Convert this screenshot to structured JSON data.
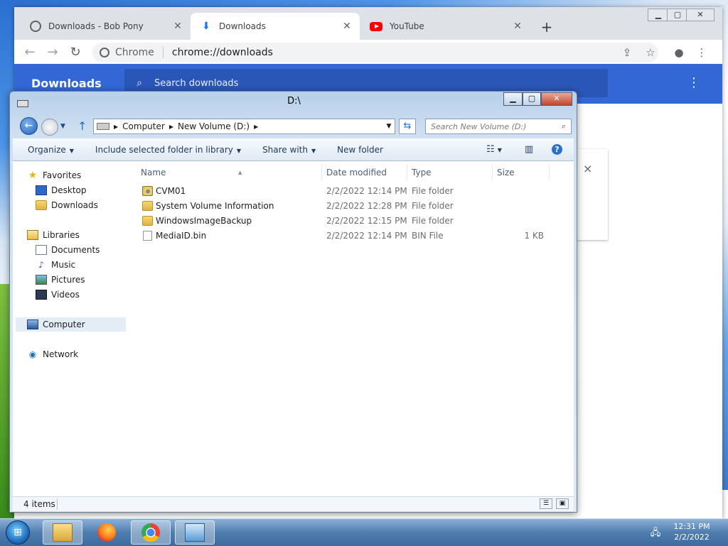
{
  "chrome": {
    "tabs": [
      {
        "title": "Downloads - Bob Pony",
        "favicon": "globe-icon",
        "active": false
      },
      {
        "title": "Downloads",
        "favicon": "download-icon",
        "active": true
      },
      {
        "title": "YouTube",
        "favicon": "youtube-icon",
        "active": false
      }
    ],
    "new_tab_label": "+",
    "omnibox": {
      "chip": "Chrome",
      "url": "chrome://downloads"
    },
    "page": {
      "title": "Downloads",
      "search_placeholder": "Search downloads"
    },
    "card_close": "×"
  },
  "explorer": {
    "title": "D:\\",
    "breadcrumbs": [
      "Computer",
      "New Volume (D:)"
    ],
    "search_placeholder": "Search New Volume (D:)",
    "commands": [
      {
        "label": "Organize",
        "dropdown": true
      },
      {
        "label": "Include selected folder in library",
        "dropdown": true
      },
      {
        "label": "Share with",
        "dropdown": true
      },
      {
        "label": "New folder",
        "dropdown": false
      }
    ],
    "nav": {
      "favorites": {
        "label": "Favorites",
        "items": [
          "Desktop",
          "Downloads"
        ]
      },
      "libraries": {
        "label": "Libraries",
        "items": [
          "Documents",
          "Music",
          "Pictures",
          "Videos"
        ]
      },
      "computer": "Computer",
      "network": "Network"
    },
    "columns": [
      "Name",
      "Date modified",
      "Type",
      "Size"
    ],
    "files": [
      {
        "name": "CVM01",
        "date": "2/2/2022 12:14 PM",
        "type": "File folder",
        "size": "",
        "icon": "mounted-folder-icon"
      },
      {
        "name": "System Volume Information",
        "date": "2/2/2022 12:28 PM",
        "type": "File folder",
        "size": "",
        "icon": "folder-icon"
      },
      {
        "name": "WindowsImageBackup",
        "date": "2/2/2022 12:15 PM",
        "type": "File folder",
        "size": "",
        "icon": "folder-icon"
      },
      {
        "name": "MediaID.bin",
        "date": "2/2/2022 12:14 PM",
        "type": "BIN File",
        "size": "1 KB",
        "icon": "file-icon"
      }
    ],
    "status": "4 items"
  },
  "taskbar": {
    "time": "12:31 PM",
    "date": "2/2/2022",
    "apps": [
      "windows-explorer-icon",
      "firefox-icon",
      "chrome-icon",
      "control-panel-icon"
    ]
  }
}
